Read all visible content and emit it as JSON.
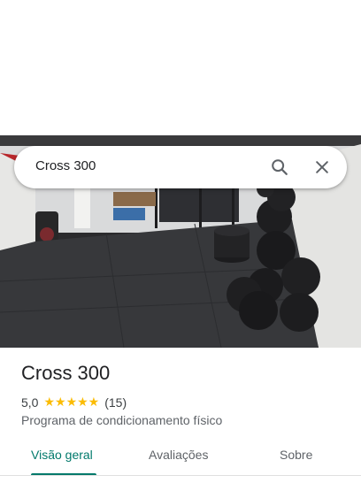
{
  "search": {
    "query": "Cross 300"
  },
  "place": {
    "name": "Cross 300",
    "rating": "5,0",
    "stars": "★★★★★",
    "review_count": "(15)",
    "category": "Programa de condicionamento físico"
  },
  "tabs": [
    {
      "label": "Visão geral",
      "active": true
    },
    {
      "label": "Avaliações",
      "active": false
    },
    {
      "label": "Sobre",
      "active": false
    }
  ],
  "icons": {
    "search": "search-icon",
    "close": "close-icon"
  },
  "colors": {
    "accent": "#00796b",
    "star": "#fbbc04"
  }
}
